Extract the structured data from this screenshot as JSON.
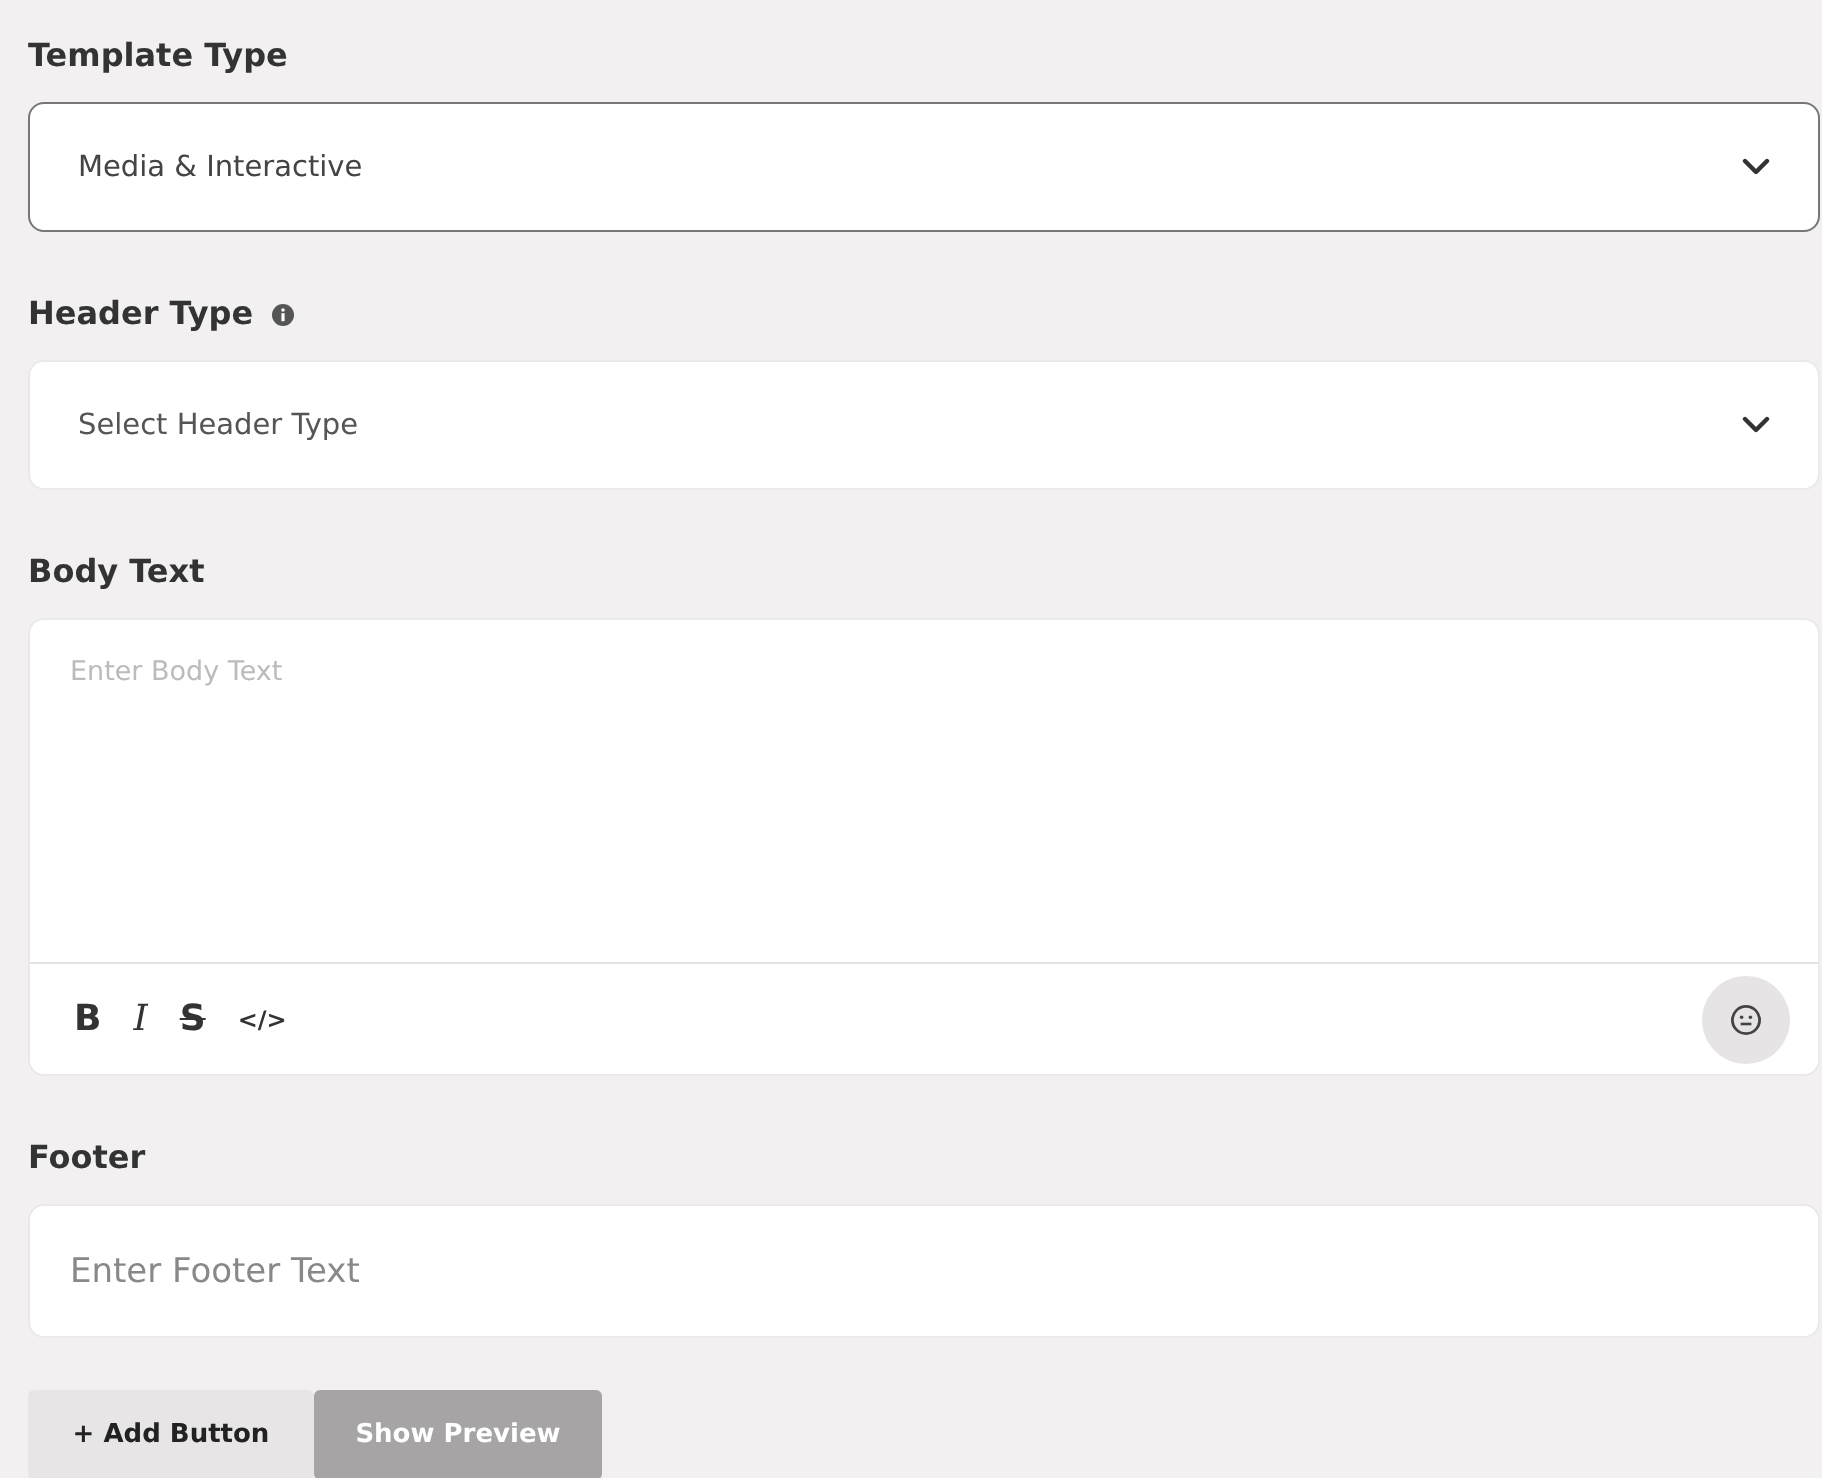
{
  "fields": [
    {
      "kind": "select",
      "label": "Template Type",
      "value": "Media & Interactive",
      "focused": true
    },
    {
      "kind": "select",
      "label": "Header Type",
      "info": true,
      "placeholder": "Select Header Type",
      "focused": false
    },
    {
      "kind": "editor",
      "label": "Body Text",
      "placeholder": "Enter Body Text",
      "toolbar": [
        {
          "kind": "bold",
          "label": "B"
        },
        {
          "kind": "italic",
          "label": "I"
        },
        {
          "kind": "strike",
          "label": "S"
        },
        {
          "kind": "code",
          "label": "</>"
        }
      ]
    },
    {
      "kind": "input",
      "label": "Footer",
      "placeholder": "Enter Footer Text"
    }
  ],
  "buttons": [
    {
      "label": "+ Add Button",
      "disabled": false
    },
    {
      "label": "Show Preview",
      "disabled": true
    }
  ]
}
